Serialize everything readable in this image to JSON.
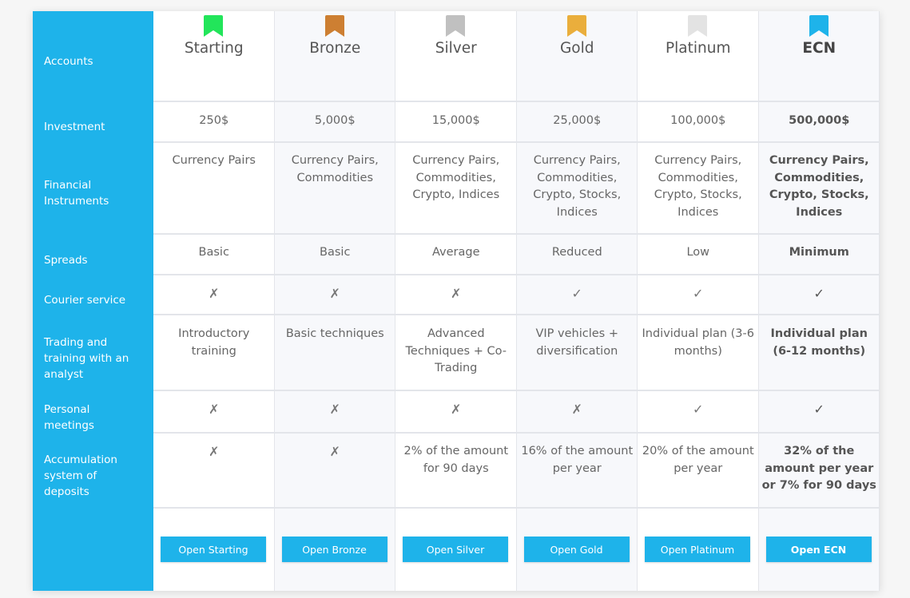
{
  "colors": {
    "accent": "#1eb3ea"
  },
  "row_labels": [
    "Accounts",
    "Investment",
    "Financial Instruments",
    "Spreads",
    "Courier service",
    "Trading and training with an analyst",
    "Personal meetings",
    "Accumulation system of deposits"
  ],
  "accounts": [
    {
      "name": "Starting",
      "bookmark_icon": "bookmark-icon",
      "bookmark_color": "#22e55a",
      "investment": "250$",
      "instruments": "Currency Pairs",
      "spreads": "Basic",
      "courier": "✗",
      "training": "Introductory training",
      "meetings": "✗",
      "accumulation": "✗",
      "button": "Open Starting"
    },
    {
      "name": "Bronze",
      "bookmark_icon": "bookmark-icon",
      "bookmark_color": "#cd7f32",
      "investment": "5,000$",
      "instruments": "Currency Pairs, Commodities",
      "spreads": "Basic",
      "courier": "✗",
      "training": "Basic techniques",
      "meetings": "✗",
      "accumulation": "✗",
      "button": "Open Bronze"
    },
    {
      "name": "Silver",
      "bookmark_icon": "bookmark-icon",
      "bookmark_color": "#c0c0c0",
      "investment": "15,000$",
      "instruments": "Currency Pairs, Commodities, Crypto, Indices",
      "spreads": "Average",
      "courier": "✗",
      "training": "Advanced Techniques + Co-Trading",
      "meetings": "✗",
      "accumulation": "2% of the amount for 90 days",
      "button": "Open Silver"
    },
    {
      "name": "Gold",
      "bookmark_icon": "bookmark-icon",
      "bookmark_color": "#eaae3c",
      "investment": "25,000$",
      "instruments": "Currency Pairs, Commodities, Crypto, Stocks, Indices",
      "spreads": "Reduced",
      "courier": "✓",
      "training": "VIP vehicles + diversification",
      "meetings": "✗",
      "accumulation": "16% of the amount per year",
      "button": "Open Gold"
    },
    {
      "name": "Platinum",
      "bookmark_icon": "bookmark-icon",
      "bookmark_color": "#e3e3e3",
      "investment": "100,000$",
      "instruments": "Currency Pairs, Commodities, Crypto, Stocks, Indices",
      "spreads": "Low",
      "courier": "✓",
      "training": "Individual plan (3-6 months)",
      "meetings": "✓",
      "accumulation": "20% of the amount per year",
      "button": "Open Platinum"
    },
    {
      "name": "ECN",
      "bookmark_icon": "bookmark-icon",
      "bookmark_color": "#1eb3ea",
      "investment": "500,000$",
      "instruments": "Currency Pairs, Commodities, Crypto, Stocks, Indices",
      "spreads": "Minimum",
      "courier": "✓",
      "training": "Individual plan (6-12 months)",
      "meetings": "✓",
      "accumulation": "32% of the amount per year or 7% for 90 days",
      "button": "Open ECN"
    }
  ]
}
